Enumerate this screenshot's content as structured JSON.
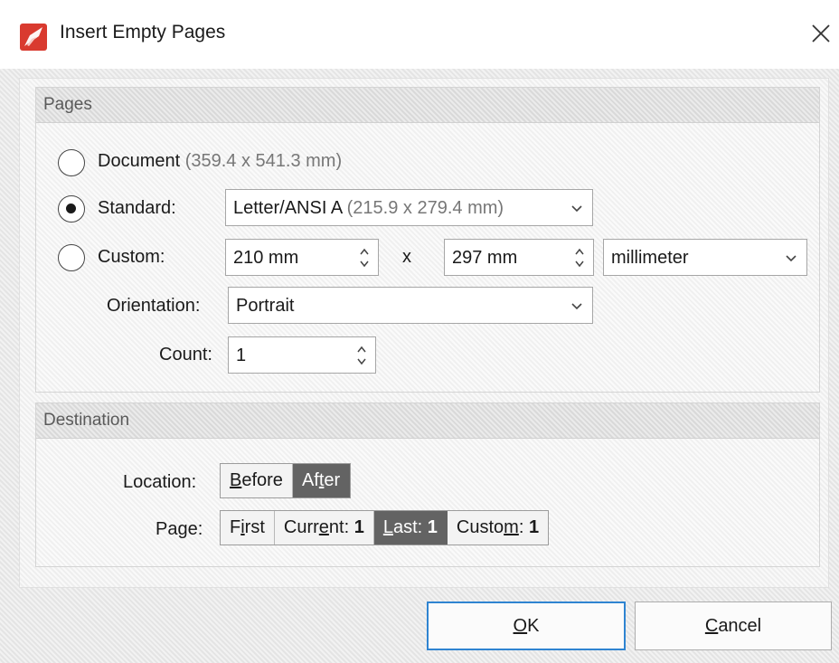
{
  "window": {
    "title": "Insert Empty Pages",
    "close_glyph": "✕"
  },
  "pages_group": {
    "header": "Pages",
    "document": {
      "label": "Document",
      "size": " (359.4 x 541.3 mm)",
      "selected": false
    },
    "standard": {
      "label": "Standard:",
      "selected": true,
      "value_main": "Letter/ANSI A",
      "value_size": " (215.9 x 279.4 mm)"
    },
    "custom": {
      "label": "Custom:",
      "selected": false,
      "width": "210 mm",
      "times": "x",
      "height": "297 mm",
      "unit": "millimeter"
    },
    "orientation": {
      "label": "Orientation:",
      "value": "Portrait"
    },
    "count": {
      "label": "Count:",
      "value": "1"
    }
  },
  "destination_group": {
    "header": "Destination",
    "location": {
      "label": "Location:",
      "options": [
        {
          "pre": "",
          "mnemonic": "B",
          "post": "efore",
          "active": false
        },
        {
          "pre": "Af",
          "mnemonic": "t",
          "post": "er",
          "active": true
        }
      ]
    },
    "page": {
      "label": "Page:",
      "options": [
        {
          "pre": "F",
          "mnemonic": "i",
          "post": "rst",
          "value": "",
          "active": false
        },
        {
          "pre": "Curr",
          "mnemonic": "e",
          "post": "nt:",
          "value": "1",
          "active": false
        },
        {
          "pre": "",
          "mnemonic": "L",
          "post": "ast:",
          "value": "1",
          "active": true
        },
        {
          "pre": "Custo",
          "mnemonic": "m",
          "post": ":",
          "value": "1",
          "active": false
        }
      ]
    }
  },
  "buttons": {
    "ok": {
      "mnemonic": "O",
      "rest": "K"
    },
    "cancel": {
      "mnemonic": "C",
      "rest": "ancel"
    }
  },
  "colors": {
    "accent": "#2f84d1",
    "segment_active": "#636363",
    "app_icon_red": "#d93a2f"
  },
  "icons": [
    "app-logo-icon",
    "close-icon",
    "chevron-down-icon",
    "spinner-updown-icon"
  ]
}
